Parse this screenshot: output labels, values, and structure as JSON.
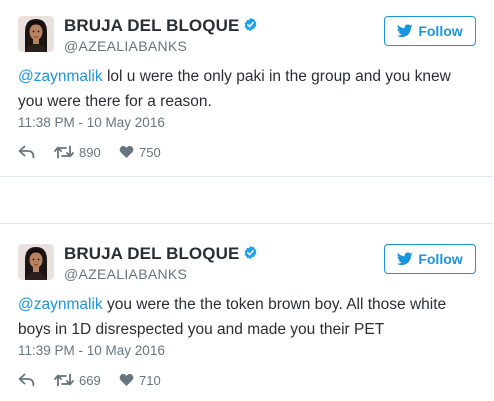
{
  "tweets": [
    {
      "display_name": "BRUJA DEL BLOQUE",
      "handle": "@AZEALIABANKS",
      "follow_label": "Follow",
      "mention": "@zaynmalik",
      "text": " lol u were the only paki in the group and you knew you were there for a reason.",
      "timestamp": "11:38 PM - 10 May 2016",
      "retweets": "890",
      "likes": "750"
    },
    {
      "display_name": "BRUJA DEL BLOQUE",
      "handle": "@AZEALIABANKS",
      "follow_label": "Follow",
      "mention": "@zaynmalik",
      "text": " you were the the token brown boy. All those white boys in 1D disrespected you and made you their PET",
      "timestamp": "11:39 PM - 10 May 2016",
      "retweets": "669",
      "likes": "710"
    }
  ],
  "icons": {
    "verified": "verified-badge-icon",
    "follow": "twitter-bird-icon",
    "reply": "reply-icon",
    "retweet": "retweet-icon",
    "like": "heart-icon"
  },
  "colors": {
    "accent": "#1b95e0",
    "text": "#292f33",
    "muted": "#66757f",
    "divider": "#e1e8ed"
  }
}
